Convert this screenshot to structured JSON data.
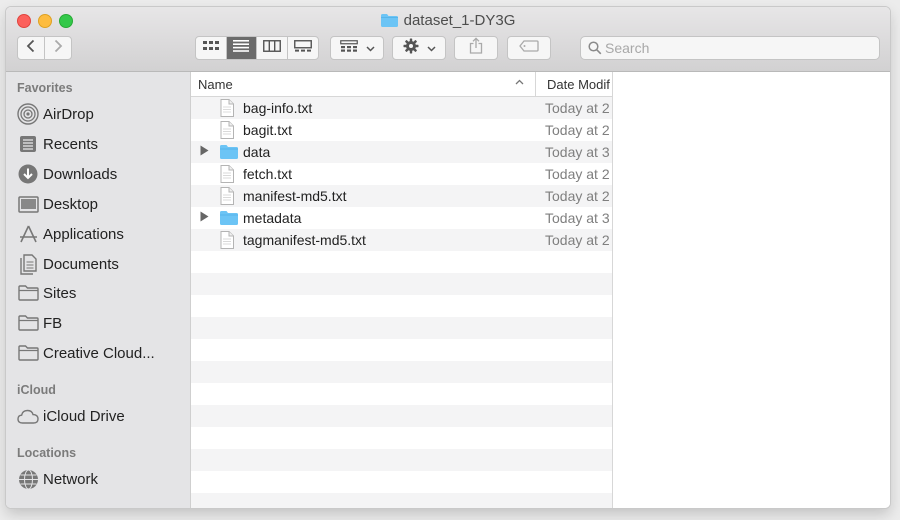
{
  "window": {
    "title": "dataset_1-DY3G"
  },
  "toolbar": {
    "icons": {
      "back": "chevron-left-icon",
      "forward": "chevron-right-icon",
      "view_icon": "grid-icon",
      "view_list": "list-icon",
      "view_column": "columns-icon",
      "view_gallery": "gallery-icon",
      "group": "group-icon",
      "action": "gear-icon",
      "share": "share-icon",
      "tag": "tag-icon"
    },
    "active_view": "list"
  },
  "search": {
    "placeholder": "Search"
  },
  "sidebar": {
    "sections": [
      {
        "heading": "Favorites",
        "items": [
          {
            "label": "AirDrop",
            "icon": "airdrop-icon"
          },
          {
            "label": "Recents",
            "icon": "recents-icon"
          },
          {
            "label": "Downloads",
            "icon": "downloads-icon"
          },
          {
            "label": "Desktop",
            "icon": "desktop-icon"
          },
          {
            "label": "Applications",
            "icon": "applications-icon"
          },
          {
            "label": "Documents",
            "icon": "documents-icon"
          },
          {
            "label": "Sites",
            "icon": "folder-icon"
          },
          {
            "label": "FB",
            "icon": "folder-icon"
          },
          {
            "label": "Creative Cloud...",
            "icon": "folder-icon"
          }
        ]
      },
      {
        "heading": "iCloud",
        "items": [
          {
            "label": "iCloud Drive",
            "icon": "cloud-icon"
          }
        ]
      },
      {
        "heading": "Locations",
        "items": [
          {
            "label": "Network",
            "icon": "network-icon"
          }
        ]
      }
    ]
  },
  "list": {
    "columns": {
      "name": "Name",
      "date": "Date Modif"
    },
    "rows": [
      {
        "name": "bag-info.txt",
        "date": "Today at 2",
        "kind": "file"
      },
      {
        "name": "bagit.txt",
        "date": "Today at 2",
        "kind": "file"
      },
      {
        "name": "data",
        "date": "Today at 3",
        "kind": "folder"
      },
      {
        "name": "fetch.txt",
        "date": "Today at 2",
        "kind": "file"
      },
      {
        "name": "manifest-md5.txt",
        "date": "Today at 2",
        "kind": "file"
      },
      {
        "name": "metadata",
        "date": "Today at 3",
        "kind": "folder"
      },
      {
        "name": "tagmanifest-md5.txt",
        "date": "Today at 2",
        "kind": "file"
      }
    ]
  },
  "colors": {
    "folder": "#6cc4f5",
    "active_segment": "#6b6b6b",
    "sidebar_bg": "#e4e4e6"
  }
}
